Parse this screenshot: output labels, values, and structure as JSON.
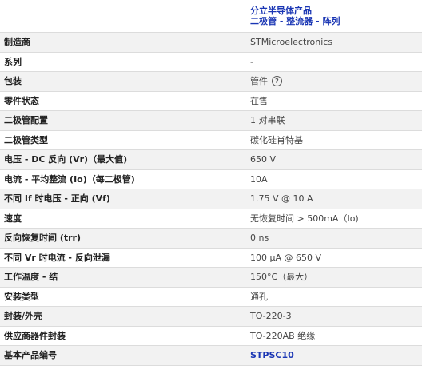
{
  "header": {
    "category_line1": "分立半导体产品",
    "category_line2": "二极管 - 整流器 - 阵列"
  },
  "specs": [
    {
      "label": "制造商",
      "value": "STMicroelectronics"
    },
    {
      "label": "系列",
      "value": "-"
    },
    {
      "label": "包装",
      "value": "管件",
      "help_icon": "question-mark-circle-icon",
      "help_glyph": "?"
    },
    {
      "label": "零件状态",
      "value": "在售"
    },
    {
      "label": "二极管配置",
      "value": "1 对串联"
    },
    {
      "label": "二极管类型",
      "value": "碳化硅肖特基"
    },
    {
      "label": "电压 - DC 反向 (Vr)（最大值)",
      "value": "650 V"
    },
    {
      "label": "电流 - 平均整流 (Io)（每二极管)",
      "value": "10A"
    },
    {
      "label": "不同 If 时电压 - 正向 (Vf)",
      "value": "1.75 V @ 10 A"
    },
    {
      "label": "速度",
      "value": "无恢复时间 > 500mA（Io)"
    },
    {
      "label": "反向恢复时间 (trr)",
      "value": "0 ns"
    },
    {
      "label": "不同 Vr 时电流 - 反向泄漏",
      "value": "100 µA @ 650 V"
    },
    {
      "label": "工作温度 - 结",
      "value": "150°C（最大）"
    },
    {
      "label": "安装类型",
      "value": "通孔"
    },
    {
      "label": "封装/外壳",
      "value": "TO-220-3"
    },
    {
      "label": "供应商器件封装",
      "value": "TO-220AB 绝缘"
    },
    {
      "label": "基本产品编号",
      "value": "STPSC10"
    }
  ],
  "colors": {
    "link": "#1a36b4",
    "row_shade": "#f2f2f2",
    "divider": "#dcdcdc"
  }
}
